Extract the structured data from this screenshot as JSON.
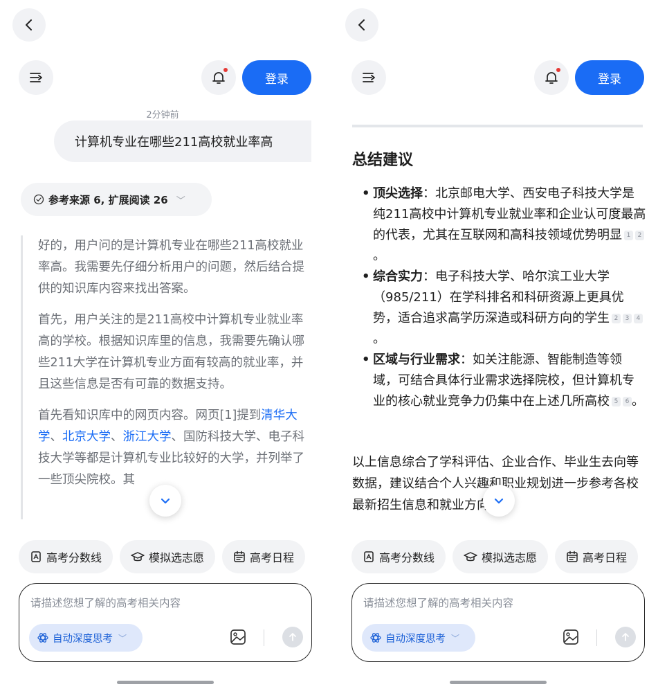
{
  "nav": {
    "login": "登录"
  },
  "chat": {
    "timestamp": "2分钟前",
    "question": "计算机专业在哪些211高校就业率高",
    "sources": "参考来源 6, 扩展阅读 26"
  },
  "thinking": {
    "p1": "好的，用户问的是计算机专业在哪些211高校就业率高。我需要先仔细分析用户的问题，然后结合提供的知识库内容来找出答案。",
    "p2": "首先，用户关注的是211高校中计算机专业就业率高的学校。根据知识库里的信息，我需要先确认哪些211大学在计算机专业方面有较高的就业率，并且这些信息是否有可靠的数据支持。",
    "p3_pre": "首先看知识库中的网页内容。网页[1]提到",
    "p3_link1": "清华大学",
    "p3_sep1": "、",
    "p3_link2": "北京大学",
    "p3_sep2": "、",
    "p3_link3": "浙江大学",
    "p3_post": "、国防科技大学、电子科技大学等都是计算机专业比较好的大学，并列举了一些顶尖院校。其"
  },
  "summary": {
    "title": "总结建议",
    "items": [
      {
        "label": "顶尖选择",
        "text": "：北京邮电大学、西安电子科技大学是纯211高校中计算机专业就业率和企业认可度最高的代表，尤其在互联网和高科技领域优势明显",
        "cites": [
          "1",
          "2"
        ],
        "end": "。"
      },
      {
        "label": "综合实力",
        "text": "：电子科技大学、哈尔滨工业大学（985/211）在学科排名和科研资源上更具优势，适合追求高学历深造或科研方向的学生",
        "cites": [
          "2",
          "3",
          "4"
        ],
        "end": "。"
      },
      {
        "label": "区域与行业需求",
        "text": "：如关注能源、智能制造等领域，可结合具体行业需求选择院校，但计算机专业的核心就业竞争力仍集中在上述几所高校",
        "cites": [
          "5",
          "6"
        ],
        "end": "。"
      }
    ],
    "conclusion": "以上信息综合了学科评估、企业合作、毕业生去向等数据，建议结合个人兴趣和职业规划进一步参考各校最新招生信息和就业方向。"
  },
  "chips": {
    "scores": "高考分数线",
    "volunteer": "模拟选志愿",
    "schedule": "高考日程"
  },
  "input": {
    "placeholder": "请描述您想了解的高考相关内容",
    "deep_think": "自动深度思考"
  },
  "colors": {
    "accent": "#1a6cf5",
    "notify": "#e53935"
  }
}
